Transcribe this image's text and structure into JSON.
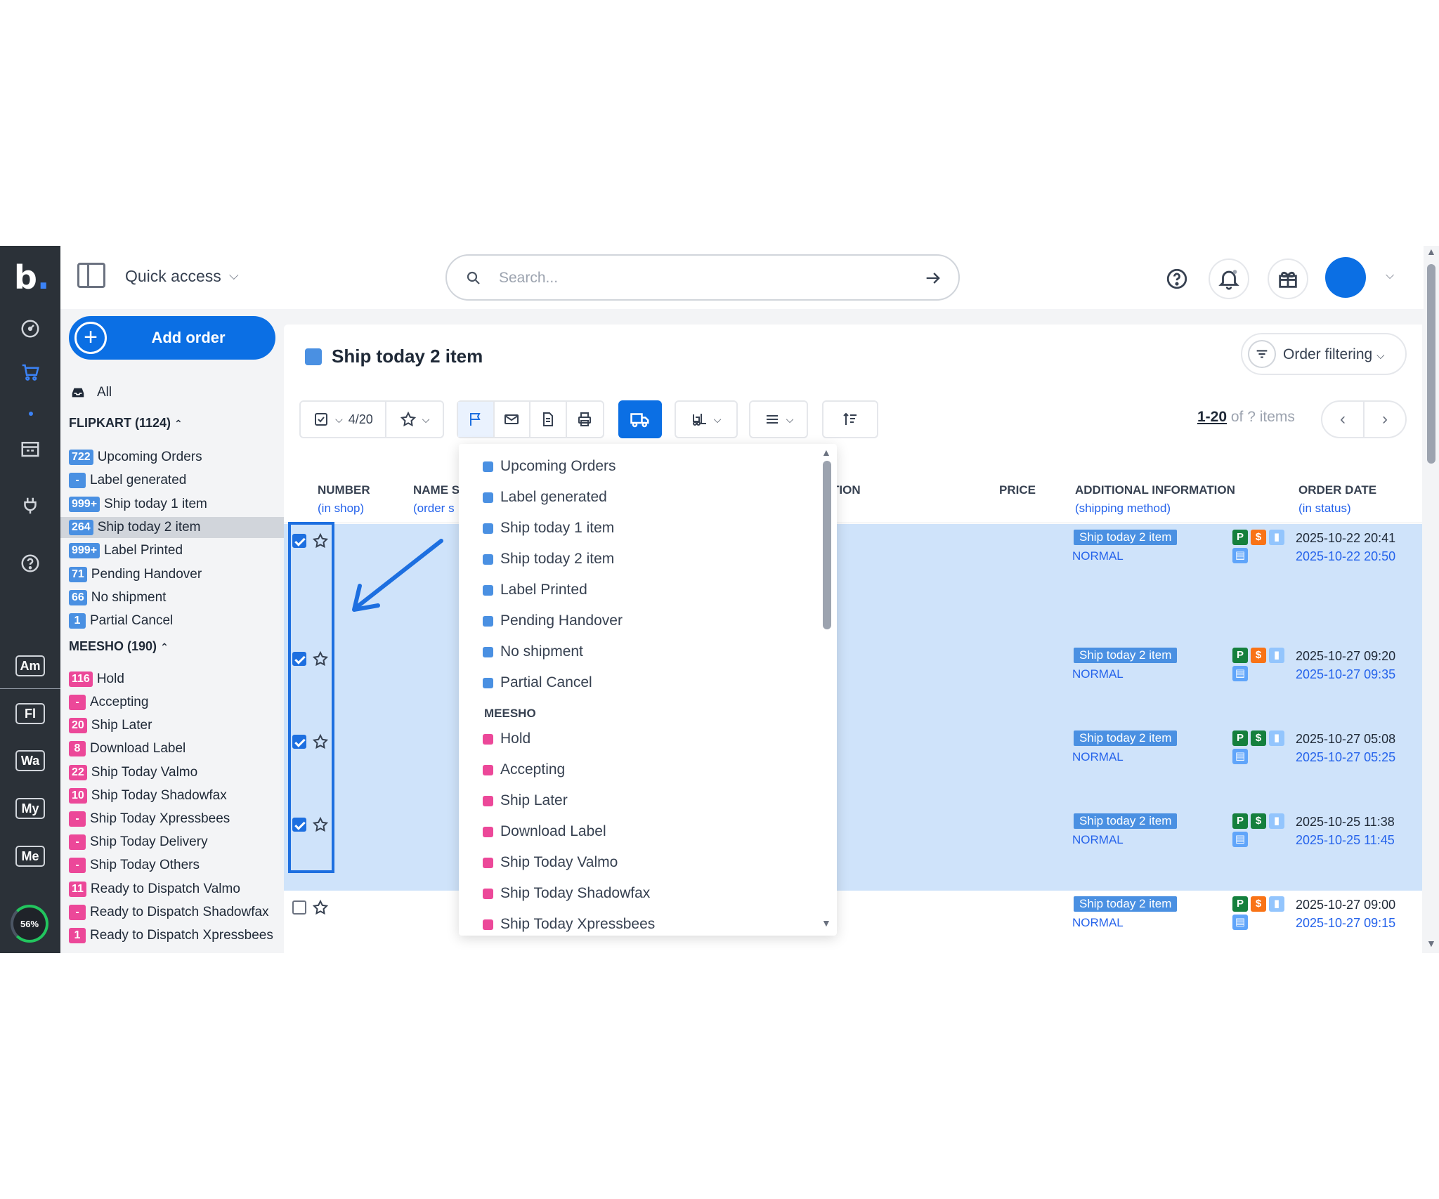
{
  "rail": {
    "logo": "b",
    "badges": [
      "Am",
      "Fl",
      "Wa",
      "My",
      "Me"
    ],
    "gauge": "56%"
  },
  "topbar": {
    "quick_access": "Quick access",
    "search_placeholder": "Search..."
  },
  "sidebar": {
    "add_order": "Add order",
    "all": "All",
    "flipkart": {
      "title": "FLIPKART (1124)",
      "items": [
        {
          "count": "722",
          "label": "Upcoming Orders"
        },
        {
          "count": "-",
          "label": "Label generated"
        },
        {
          "count": "999+",
          "label": "Ship today 1 item"
        },
        {
          "count": "264",
          "label": "Ship today 2 item"
        },
        {
          "count": "999+",
          "label": "Label Printed"
        },
        {
          "count": "71",
          "label": "Pending Handover"
        },
        {
          "count": "66",
          "label": "No shipment"
        },
        {
          "count": "1",
          "label": "Partial Cancel"
        }
      ]
    },
    "meesho": {
      "title": "MEESHO (190)",
      "items": [
        {
          "count": "116",
          "label": "Hold"
        },
        {
          "count": "-",
          "label": "Accepting"
        },
        {
          "count": "20",
          "label": "Ship Later"
        },
        {
          "count": "8",
          "label": "Download Label"
        },
        {
          "count": "22",
          "label": "Ship Today Valmo"
        },
        {
          "count": "10",
          "label": "Ship Today Shadowfax"
        },
        {
          "count": "-",
          "label": "Ship Today Xpressbees"
        },
        {
          "count": "-",
          "label": "Ship Today Delivery"
        },
        {
          "count": "-",
          "label": "Ship Today Others"
        },
        {
          "count": "11",
          "label": "Ready to Dispatch Valmo"
        },
        {
          "count": "-",
          "label": "Ready to Dispatch Shadowfax"
        },
        {
          "count": "1",
          "label": "Ready to Dispatch Xpressbees"
        }
      ]
    }
  },
  "main": {
    "title": "Ship today 2 item",
    "order_filtering": "Order filtering",
    "selection_count": "4/20",
    "pager_range": "1-20",
    "pager_of": " of ? items",
    "columns": {
      "number": "NUMBER",
      "number_sub": "(in shop)",
      "name": "NAME S",
      "name_sub": "(order s",
      "action": "TION",
      "price": "PRICE",
      "additional": "ADDITIONAL INFORMATION",
      "additional_sub": "(shipping method)",
      "order_date": "ORDER DATE",
      "order_date_sub": "(in status)"
    },
    "rows": [
      {
        "tag": "Ship today 2 item",
        "method": "NORMAL",
        "d1": "2025-10-22 20:41",
        "d2": "2025-10-22 20:50",
        "checked": true
      },
      {
        "tag": "Ship today 2 item",
        "method": "NORMAL",
        "d1": "2025-10-27 09:20",
        "d2": "2025-10-27 09:35",
        "checked": true
      },
      {
        "tag": "Ship today 2 item",
        "method": "NORMAL",
        "d1": "2025-10-27 05:08",
        "d2": "2025-10-27 05:25",
        "checked": true
      },
      {
        "tag": "Ship today 2 item",
        "method": "NORMAL",
        "d1": "2025-10-25 11:38",
        "d2": "2025-10-25 11:45",
        "checked": true
      },
      {
        "tag": "Ship today 2 item",
        "method": "NORMAL",
        "d1": "2025-10-27 09:00",
        "d2": "2025-10-27 09:15",
        "checked": false
      }
    ]
  },
  "dropdown": {
    "flipkart_items": [
      "Upcoming Orders",
      "Label generated",
      "Ship today 1 item",
      "Ship today 2 item",
      "Label Printed",
      "Pending Handover",
      "No shipment",
      "Partial Cancel"
    ],
    "meesho_title": "MEESHO",
    "meesho_items": [
      "Hold",
      "Accepting",
      "Ship Later",
      "Download Label",
      "Ship Today Valmo",
      "Ship Today Shadowfax",
      "Ship Today Xpressbees"
    ]
  },
  "colors": {
    "primary": "#0b6fe4",
    "flipkart_status": "#4a90e2",
    "meesho_status": "#ec4899",
    "row_selected": "#cfe3fa",
    "rail": "#2b3138"
  }
}
